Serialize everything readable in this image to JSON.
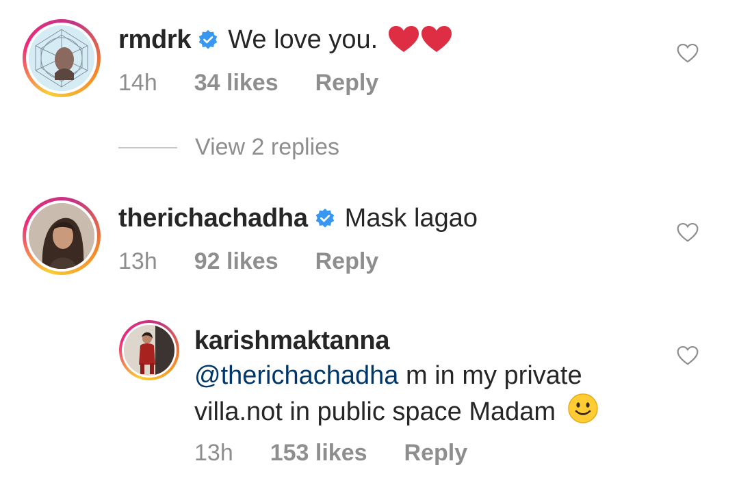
{
  "comments": [
    {
      "username": "rmdrk",
      "verified": true,
      "text": "We love you.",
      "emoji": "❤️❤️",
      "time": "14h",
      "likes": "34 likes",
      "reply_label": "Reply",
      "view_replies": "View 2 replies"
    },
    {
      "username": "therichachadha",
      "verified": true,
      "text": "Mask lagao",
      "time": "13h",
      "likes": "92 likes",
      "reply_label": "Reply"
    }
  ],
  "reply": {
    "username": "karishmaktanna",
    "mention": "@therichachadha",
    "text_line1": " m in my private",
    "text_line2": "villa.not in public space Madam",
    "emoji": "🙂",
    "time": "13h",
    "likes": "153 likes",
    "reply_label": "Reply"
  },
  "colors": {
    "text": "#262626",
    "secondary": "#8e8e8e",
    "verified_blue": "#3897f0",
    "mention": "#00376b",
    "heart_red": "#e0245e"
  },
  "icons": {
    "verified": "verified-badge-icon",
    "like": "heart-outline-icon"
  }
}
